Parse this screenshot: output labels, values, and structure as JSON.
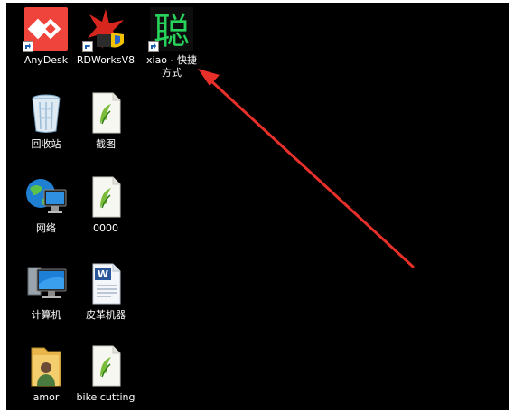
{
  "desktop": {
    "icons": [
      {
        "label": "AnyDesk",
        "type": "anydesk",
        "shortcut": true
      },
      {
        "label": "RDWorksV8",
        "type": "rdworks",
        "shortcut": true
      },
      {
        "label": "xiao - 快捷方式",
        "type": "xiao",
        "shortcut": true
      },
      {
        "label": "回收站",
        "type": "recycle-bin",
        "shortcut": false
      },
      {
        "label": "截图",
        "type": "document",
        "shortcut": false
      },
      {
        "label": "网络",
        "type": "network",
        "shortcut": false
      },
      {
        "label": "0000",
        "type": "document",
        "shortcut": false
      },
      {
        "label": "计算机",
        "type": "computer",
        "shortcut": false
      },
      {
        "label": "皮革机器",
        "type": "word-doc",
        "shortcut": false
      },
      {
        "label": "amor",
        "type": "user-folder",
        "shortcut": false
      },
      {
        "label": "bike cutting",
        "type": "document",
        "shortcut": false
      }
    ],
    "xiao_glyph": "聪",
    "background_color": "#000000",
    "arrow_color": "#e8302a"
  }
}
